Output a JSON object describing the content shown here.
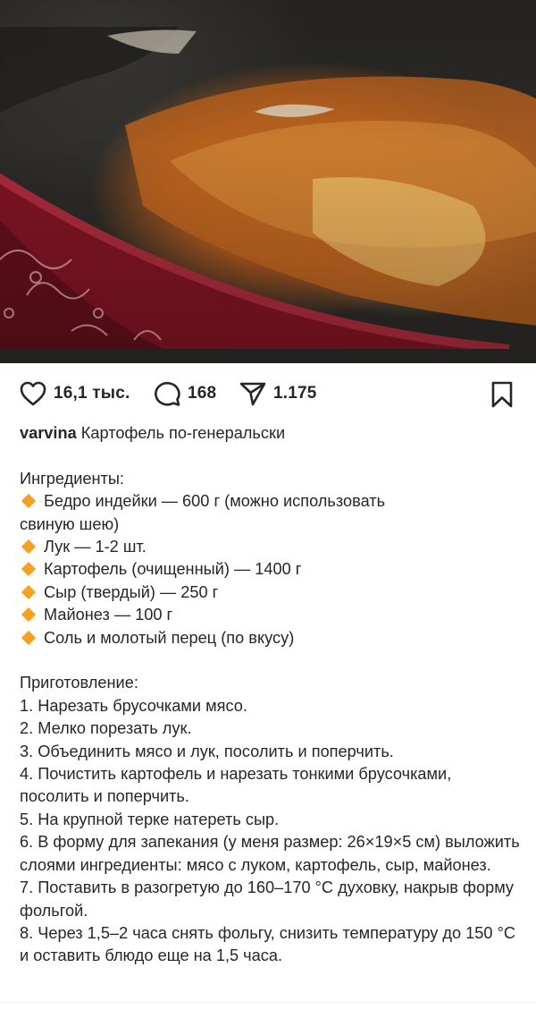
{
  "post": {
    "actions": {
      "likes": "16,1 тыс.",
      "comments": "168",
      "shares": "1.175"
    },
    "caption": {
      "username": "varvina",
      "title": "Картофель по-генеральски",
      "ingredients_header": "Ингредиенты:",
      "ingredients": [
        {
          "line1": "Бедро индейки — 600 г (можно использовать",
          "line2": "свиную шею)"
        },
        {
          "line1": "Лук — 1-2 шт."
        },
        {
          "line1": "Картофель (очищенный) — 1400 г"
        },
        {
          "line1": "Сыр (твердый) — 250 г"
        },
        {
          "line1": "Майонез — 100 г"
        },
        {
          "line1": "Соль и молотый перец (по вкусу)"
        }
      ],
      "steps_header": "Приготовление:",
      "steps": [
        "1. Нарезать брусочками мясо.",
        "2. Мелко порезать лук.",
        "3. Объединить мясо и лук, посолить и поперчить.",
        "4. Почистить картофель и нарезать тонкими брусочками, посолить и поперчить.",
        "5. На крупной терке натереть сыр.",
        "6. В форму для запекания (у меня размер: 26×19×5 см) выложить слоями ингредиенты: мясо с луком, картофель, сыр, майонез.",
        "7. Поставить в разогретую до 160–170 °С духовку, накрыв форму фольгой.",
        "8. Через 1,5–2 часа снять фольгу, снизить температуру до 150 °С и оставить блюдо еще на 1,5 часа."
      ]
    },
    "icons": {
      "like": "heart-icon",
      "comment": "comment-bubble-icon",
      "share": "paper-plane-icon",
      "save": "bookmark-icon",
      "bullet": "orange-diamond-icon"
    },
    "colors": {
      "text": "#262626",
      "bullet": "#f4a21f",
      "dish": "#8e1c2a"
    }
  }
}
